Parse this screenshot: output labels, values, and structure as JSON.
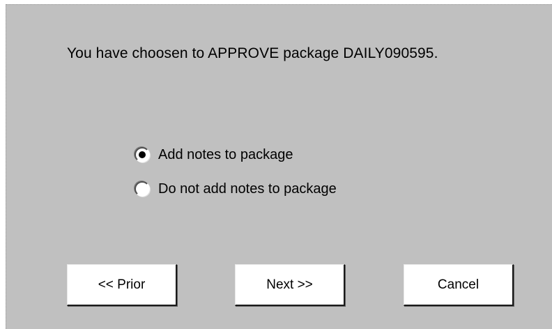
{
  "message": "You have choosen to APPROVE package DAILY090595.",
  "options": [
    {
      "label": "Add notes to package",
      "selected": true
    },
    {
      "label": "Do not add notes to package",
      "selected": false
    }
  ],
  "buttons": {
    "prior": "<< Prior",
    "next": "Next >>",
    "cancel": "Cancel"
  }
}
